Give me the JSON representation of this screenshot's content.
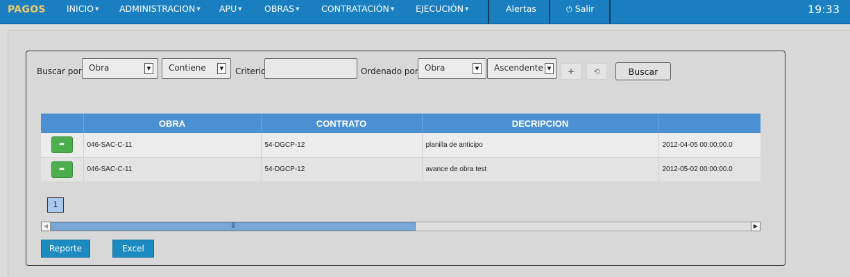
{
  "nav": {
    "brand": "PAGOS",
    "items": [
      {
        "label": "INICIO"
      },
      {
        "label": "ADMINISTRACION"
      },
      {
        "label": "APU"
      },
      {
        "label": "OBRAS"
      },
      {
        "label": "CONTRATACIÓN"
      },
      {
        "label": "EJECUCIÓN"
      }
    ],
    "alertas": "Alertas",
    "salir": "Salir",
    "clock": "19:33"
  },
  "search": {
    "buscar_por_label": "Buscar por:",
    "field_value": "Obra",
    "operator_value": "Contiene",
    "criterio_label": "Criterio:",
    "criterio_value": "",
    "ordenado_por_label": "Ordenado por:",
    "order_field_value": "Obra",
    "order_dir_value": "Ascendente",
    "buscar_button": "Buscar"
  },
  "table": {
    "columns": [
      "",
      "OBRA",
      "CONTRATO",
      "DECRIPCION",
      ""
    ],
    "rows": [
      {
        "obra": "046-SAC-C-11",
        "contrato": "54-DGCP-12",
        "descripcion": "planilla de anticipo",
        "fecha": "2012-04-05 00:00:00.0"
      },
      {
        "obra": "046-SAC-C-11",
        "contrato": "54-DGCP-12",
        "descripcion": "avance de obra test",
        "fecha": "2012-05-02 00:00:00.0"
      }
    ]
  },
  "pager": {
    "current_page": "1"
  },
  "actions": {
    "reporte": "Reporte",
    "excel": "Excel"
  },
  "colors": {
    "navbar": "#1a7fc1",
    "brand": "#f0c96a",
    "table_header": "#4a90d2",
    "row_button": "#4cae4c",
    "action_button": "#1c8bc0",
    "page_active": "#a9c8f0"
  },
  "icons": {
    "power": "power-icon",
    "caret": "caret-down-icon",
    "row_action": "share-icon",
    "add": "plus-icon",
    "refresh": "refresh-icon"
  }
}
